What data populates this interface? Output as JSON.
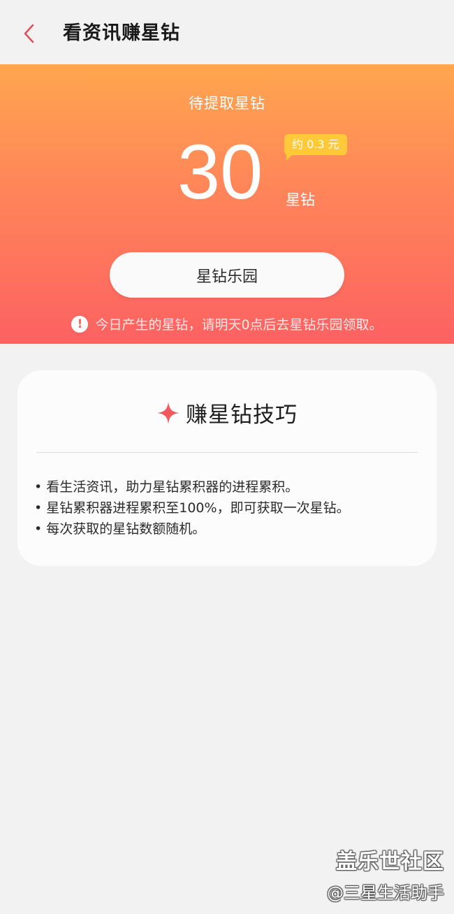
{
  "header": {
    "title": "看资讯赚星钻",
    "back_icon": "chevron-left-icon",
    "back_color": "#e0525b"
  },
  "hero": {
    "label": "待提取星钻",
    "amount": "30",
    "unit": "星钻",
    "approx": "约 0.3 元",
    "button_label": "星钻乐园",
    "notice_icon_glyph": "!",
    "notice": "今日产生的星钻，请明天0点后去星钻乐园领取。",
    "gradient_top": "#ffa64f",
    "gradient_bottom": "#fc6162",
    "bubble_color": "#ffc93a"
  },
  "tips_card": {
    "icon": "sparkle-icon",
    "icon_color": "#f0585e",
    "title": "赚星钻技巧",
    "items": [
      "看生活资讯，助力星钻累积器的进程累积。",
      "星钻累积器进程累积至100%，即可获取一次星钻。",
      "每次获取的星钻数额随机。"
    ]
  },
  "watermark": {
    "line1": "盖乐世社区",
    "line2": "@三星生活助手"
  }
}
